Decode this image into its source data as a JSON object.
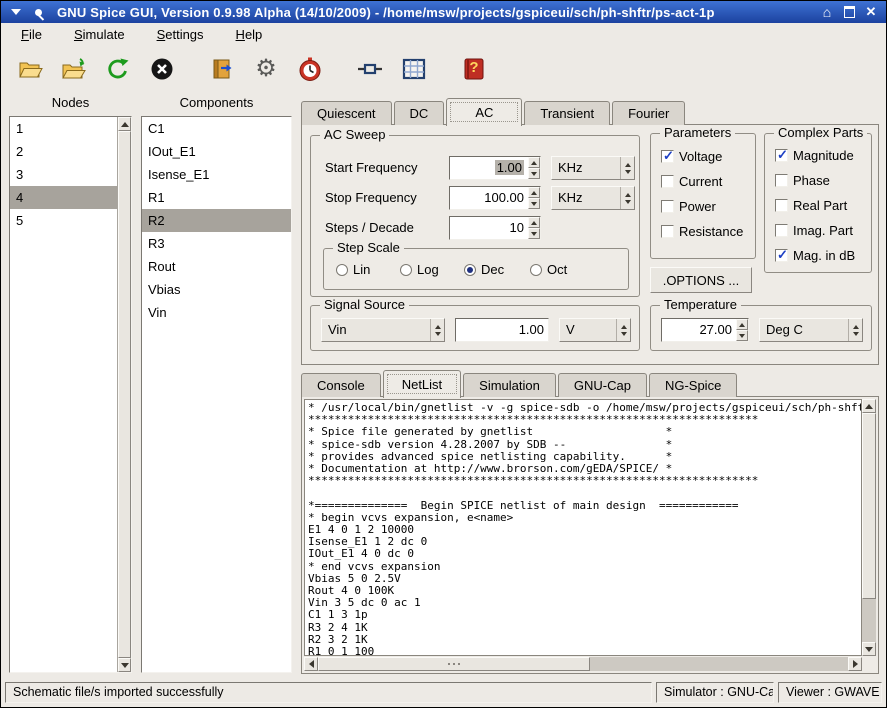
{
  "window": {
    "title": "GNU Spice GUI,  Version 0.9.98 Alpha (14/10/2009)  -  /home/msw/projects/gspiceui/sch/ph-shftr/ps-act-1p"
  },
  "menu": {
    "file": "File",
    "simulate": "Simulate",
    "settings": "Settings",
    "help": "Help"
  },
  "toolbar": {
    "buttons": [
      "open-folder",
      "import-folder",
      "refresh",
      "stop",
      "export-book",
      "settings-gear",
      "stopwatch",
      "component",
      "waveform-grid",
      "help-book"
    ]
  },
  "nodes": {
    "label": "Nodes",
    "items": [
      "1",
      "2",
      "3",
      "4",
      "5"
    ],
    "selected": "4"
  },
  "components": {
    "label": "Components",
    "items": [
      "C1",
      "IOut_E1",
      "Isense_E1",
      "R1",
      "R2",
      "R3",
      "Rout",
      "Vbias",
      "Vin"
    ],
    "selected": "R2"
  },
  "analysis": {
    "tabs": [
      "Quiescent",
      "DC",
      "AC",
      "Transient",
      "Fourier"
    ],
    "selected": "AC"
  },
  "ac_sweep": {
    "title": "AC Sweep",
    "start_label": "Start Frequency",
    "start_value": "1.00",
    "start_unit": "KHz",
    "stop_label": "Stop Frequency",
    "stop_value": "100.00",
    "stop_unit": "KHz",
    "steps_label": "Steps / Decade",
    "steps_value": "10",
    "step_scale": {
      "title": "Step Scale",
      "options": [
        "Lin",
        "Log",
        "Dec",
        "Oct"
      ],
      "selected": "Dec"
    }
  },
  "parameters": {
    "title": "Parameters",
    "options": [
      {
        "label": "Voltage",
        "checked": true
      },
      {
        "label": "Current",
        "checked": false
      },
      {
        "label": "Power",
        "checked": false
      },
      {
        "label": "Resistance",
        "checked": false
      }
    ]
  },
  "complex_parts": {
    "title": "Complex Parts",
    "options": [
      {
        "label": "Magnitude",
        "checked": true
      },
      {
        "label": "Phase",
        "checked": false
      },
      {
        "label": "Real Part",
        "checked": false
      },
      {
        "label": "Imag. Part",
        "checked": false
      },
      {
        "label": "Mag. in dB",
        "checked": true
      }
    ]
  },
  "options_button": ".OPTIONS ...",
  "signal_source": {
    "title": "Signal Source",
    "source": "Vin",
    "value": "1.00",
    "unit": "V"
  },
  "temperature": {
    "title": "Temperature",
    "value": "27.00",
    "unit": "Deg C"
  },
  "output": {
    "tabs": [
      "Console",
      "NetList",
      "Simulation",
      "GNU-Cap",
      "NG-Spice"
    ],
    "selected": "NetList"
  },
  "netlist": {
    "lines": [
      "* /usr/local/bin/gnetlist -v -g spice-sdb -o /home/msw/projects/gspiceui/sch/ph-shftr/ps-act",
      "********************************************************************",
      "* Spice file generated by gnetlist                    *",
      "* spice-sdb version 4.28.2007 by SDB --               *",
      "* provides advanced spice netlisting capability.      *",
      "* Documentation at http://www.brorson.com/gEDA/SPICE/ *",
      "********************************************************************",
      "",
      "*==============  Begin SPICE netlist of main design  ============",
      "* begin vcvs expansion, e<name>",
      "E1 4 0 1 2 10000",
      "Isense_E1 1 2 dc 0",
      "IOut_E1 4 0 dc 0",
      "* end vcvs expansion",
      "Vbias 5 0 2.5V",
      "Rout 4 0 100K",
      "Vin 3 5 dc 0 ac 1",
      "C1 1 3 1p",
      "R3 2 4 1K",
      "R2 3 2 1K",
      "R1 0 1 100"
    ]
  },
  "status": {
    "message": "Schematic file/s imported successfully",
    "simulator": "Simulator : GNU-Cap",
    "viewer": "Viewer : GWAVE"
  }
}
